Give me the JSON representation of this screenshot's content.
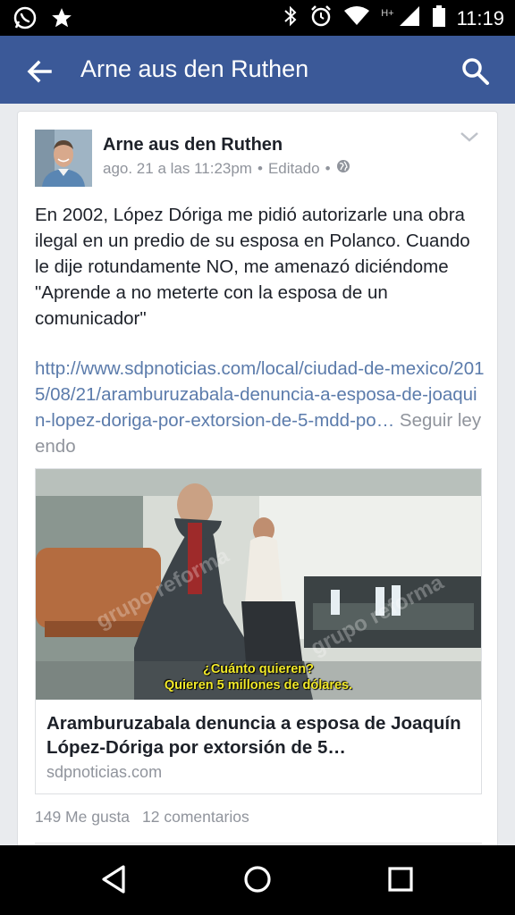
{
  "status_bar": {
    "time": "11:19",
    "network_label": "H+",
    "icons": [
      "whatsapp-icon",
      "star-icon",
      "bluetooth-icon",
      "alarm-icon",
      "wifi-icon",
      "signal-icon",
      "battery-icon"
    ]
  },
  "app_bar": {
    "title": "Arne aus den Ruthen",
    "back_icon": "arrow-back-icon",
    "search_icon": "search-icon",
    "background": "#3b5998"
  },
  "post": {
    "author": "Arne aus den Ruthen",
    "timestamp": "ago. 21 a las 11:23pm",
    "separator": "•",
    "edited": "Editado",
    "privacy_icon": "globe-icon",
    "text": "En 2002, López Dóriga me pidió autorizarle una obra ilegal en un predio de su esposa en Polanco. Cuando le dije rotundamente NO, me amenazó diciéndome \"Aprende a no meterte con la esposa de un comunicador\"",
    "link": "http://www.sdpnoticias.com/local/ciudad-de-mexico/2015/08/21/aramburuzabala-denuncia-a-esposa-de-joaquin-lopez-doriga-por-extorsion-de-5-mdd-po…",
    "see_more": "Seguir leyendo",
    "preview": {
      "subtitle_line1": "¿Cuánto quieren?",
      "subtitle_line2": "Quieren 5 millones de dólares.",
      "watermark": "grupo reforma",
      "title": "Aramburuzabala denuncia a esposa de Joaquín López-Dóriga por extorsión de 5…",
      "domain": "sdpnoticias.com"
    },
    "likes": "149 Me gusta",
    "comments": "12 comentarios"
  },
  "nav_bar": {
    "icons": [
      "back-triangle-icon",
      "home-circle-icon",
      "recents-square-icon"
    ]
  },
  "colors": {
    "link": "#5b7bab",
    "muted": "#90949c",
    "subtitle": "#f2ea2a"
  }
}
